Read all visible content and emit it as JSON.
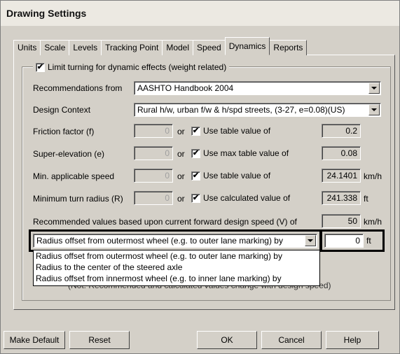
{
  "window": {
    "title": "Drawing Settings"
  },
  "tabs": [
    {
      "label": "Units"
    },
    {
      "label": "Scale"
    },
    {
      "label": "Levels"
    },
    {
      "label": "Tracking Point"
    },
    {
      "label": "Model"
    },
    {
      "label": "Speed"
    },
    {
      "label": "Dynamics",
      "active": true
    },
    {
      "label": "Reports"
    }
  ],
  "group": {
    "checked": true,
    "label": "Limit turning for dynamic effects (weight related)"
  },
  "recommendations": {
    "label": "Recommendations from",
    "value": "AASHTO Handbook 2004"
  },
  "design_context": {
    "label": "Design Context",
    "value": "Rural h/w, urban f/w & h/spd streets, (3-27, e=0.08)(US)"
  },
  "rows": [
    {
      "label": "Friction factor (f)",
      "input": "0",
      "or": "or",
      "checked": true,
      "check_label": "Use table value of",
      "value": "0.2",
      "unit": ""
    },
    {
      "label": "Super-elevation (e)",
      "input": "0",
      "or": "or",
      "checked": true,
      "check_label": "Use max table value of",
      "value": "0.08",
      "unit": ""
    },
    {
      "label": "Min. applicable speed",
      "input": "0",
      "or": "or",
      "checked": true,
      "check_label": "Use table value of",
      "value": "24.1401",
      "unit": "km/h"
    },
    {
      "label": "Minimum turn radius (R)",
      "input": "0",
      "or": "or",
      "checked": true,
      "check_label": "Use calculated value of",
      "value": "241.338",
      "unit": "ft"
    }
  ],
  "recommended": {
    "label": "Recommended values based upon current forward design speed (V) of",
    "value": "50",
    "unit": "km/h"
  },
  "radius": {
    "selected": "Radius offset from outermost wheel (e.g. to outer lane marking) by",
    "value": "0",
    "unit": "ft"
  },
  "dropdown_options": [
    "Radius offset from outermost wheel (e.g. to outer lane marking) by",
    "Radius to the center of the steered axle",
    "Radius offset from innermost wheel (e.g. to inner lane marking) by"
  ],
  "partial_note": {
    "left": "(Not: Recommended and calculated values change with design speed)",
    "right": "speed)"
  },
  "buttons": {
    "make_default": "Make Default",
    "reset": "Reset",
    "ok": "OK",
    "cancel": "Cancel",
    "help": "Help"
  }
}
